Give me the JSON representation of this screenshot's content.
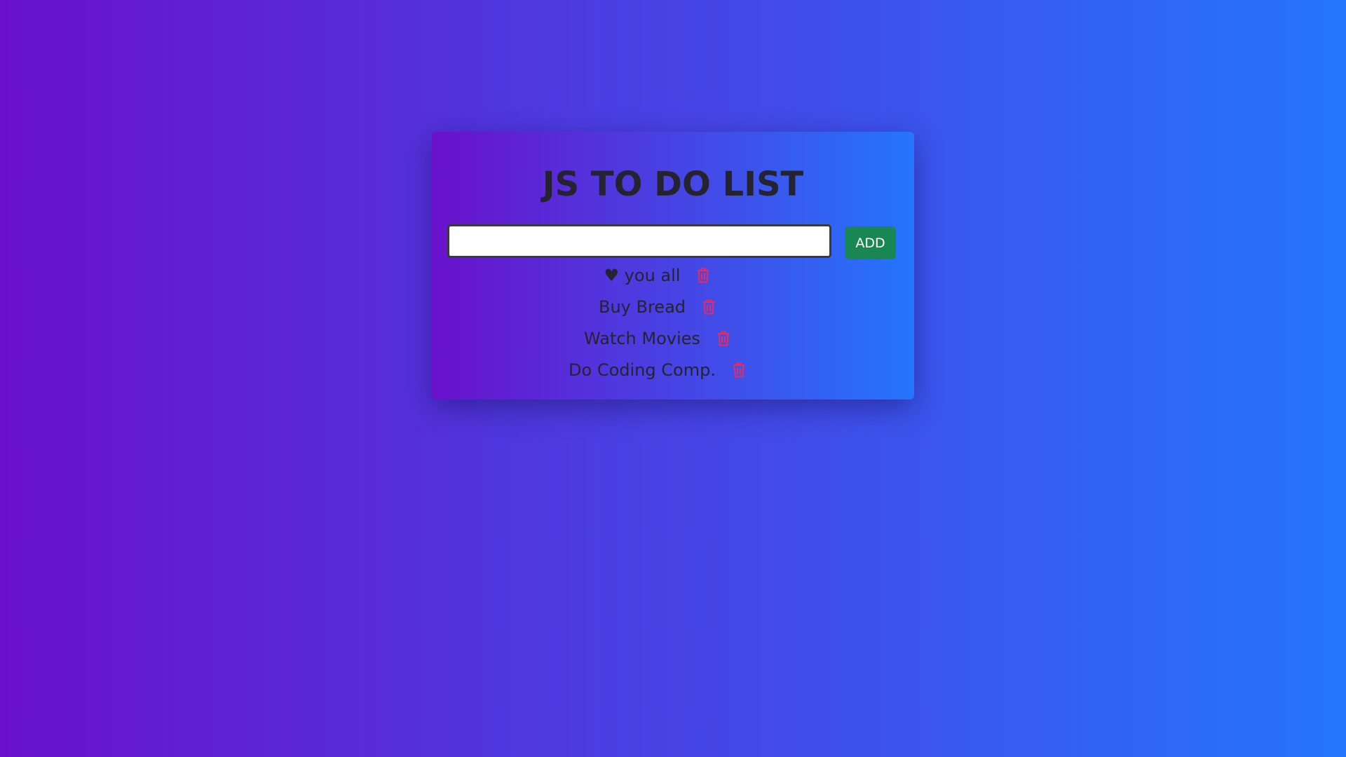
{
  "app": {
    "title": "JS TO DO LIST"
  },
  "input": {
    "value": "",
    "placeholder": ""
  },
  "add_button": {
    "label": "ADD"
  },
  "items": [
    {
      "text": "♥ you all",
      "icon": "trash-icon"
    },
    {
      "text": "Buy Bread",
      "icon": "trash-icon"
    },
    {
      "text": "Watch Movies",
      "icon": "trash-icon"
    },
    {
      "text": "Do Coding Comp.",
      "icon": "trash-icon"
    }
  ],
  "colors": {
    "background_start": "#6a11cb",
    "background_end": "#2575fc",
    "add_button": "#198754",
    "trash_icon": "#ea2a5a",
    "text": "#262330"
  }
}
